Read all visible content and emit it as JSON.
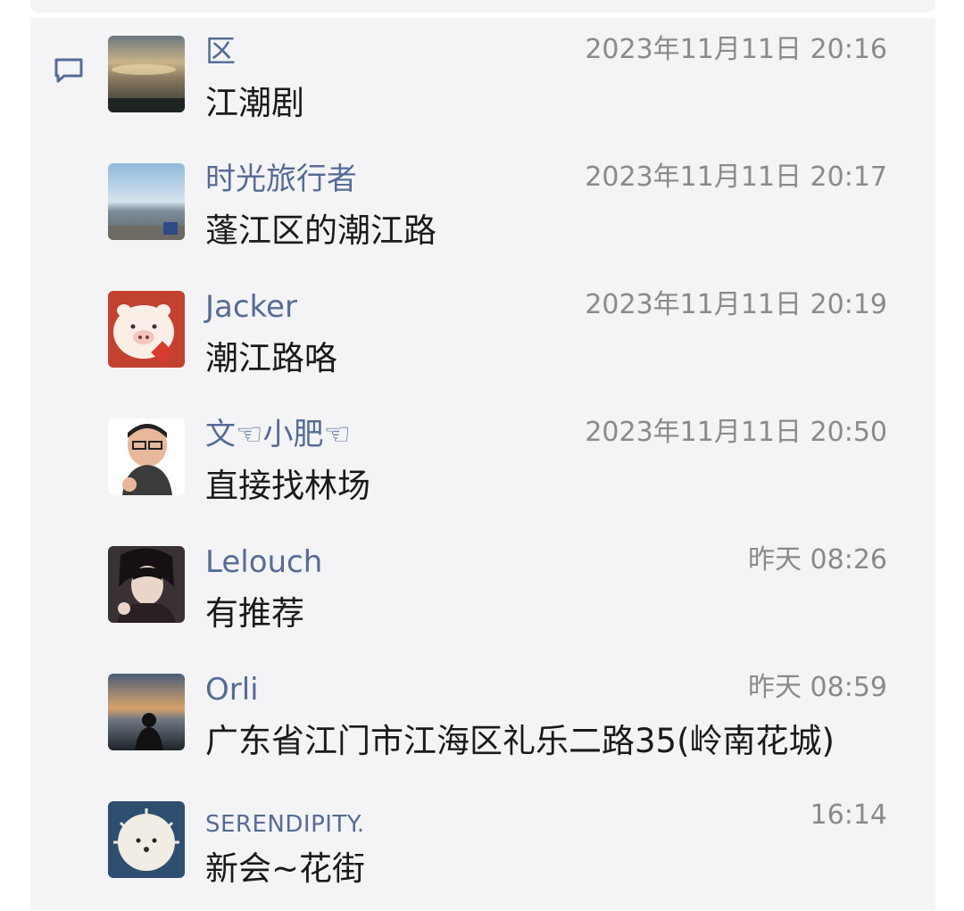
{
  "icons": {
    "comment": "comment-icon"
  },
  "colors": {
    "name": "#576b95",
    "time": "#8a8a8a",
    "text": "#1a1a1a",
    "panel_bg": "#f4f4f6"
  },
  "comments": [
    {
      "name": "区",
      "time": "2023年11月11日 20:16",
      "text": "江潮剧"
    },
    {
      "name": "时光旅行者",
      "time": "2023年11月11日 20:17",
      "text": "蓬江区的潮江路"
    },
    {
      "name": "Jacker",
      "time": "2023年11月11日 20:19",
      "text": "潮江路咯"
    },
    {
      "name": "文☜小肥☜",
      "time": "2023年11月11日 20:50",
      "text": "直接找林场"
    },
    {
      "name": "Lelouch",
      "time": "昨天 08:26",
      "text": "有推荐"
    },
    {
      "name": "Orli",
      "time": "昨天 08:59",
      "text": "广东省江门市江海区礼乐二路35(岭南花城)"
    },
    {
      "name": "SERENDIPITY.",
      "time": "16:14",
      "text": "新会~花街"
    }
  ]
}
